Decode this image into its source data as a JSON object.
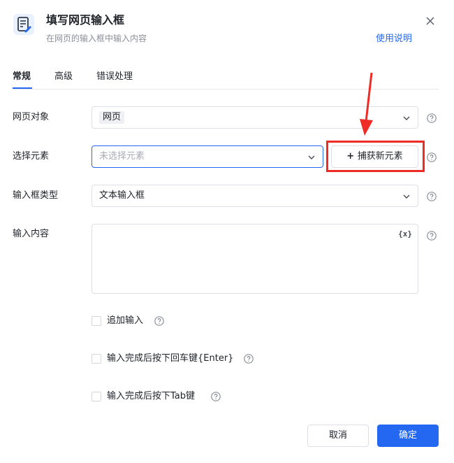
{
  "header": {
    "title": "填写网页输入框",
    "subtitle": "在网页的输入框中输入内容",
    "help_link": "使用说明"
  },
  "tabs": [
    {
      "label": "常规",
      "active": true
    },
    {
      "label": "高级",
      "active": false
    },
    {
      "label": "错误处理",
      "active": false
    }
  ],
  "fields": {
    "web_object": {
      "label": "网页对象",
      "value": "网页"
    },
    "select_element": {
      "label": "选择元素",
      "placeholder": "未选择元素",
      "capture_label": "捕获新元素"
    },
    "input_type": {
      "label": "输入框类型",
      "value": "文本输入框"
    },
    "input_content": {
      "label": "输入内容",
      "var_icon": "{x}"
    }
  },
  "options": [
    {
      "label": "追加输入",
      "checked": false
    },
    {
      "label": "输入完成后按下回车键{Enter}",
      "checked": false
    },
    {
      "label": "输入完成后按下Tab键",
      "checked": false
    }
  ],
  "footer": {
    "cancel_label": "取消",
    "ok_label": "确定"
  },
  "colors": {
    "primary": "#2468f2",
    "annotation_red": "#ee2b24"
  }
}
